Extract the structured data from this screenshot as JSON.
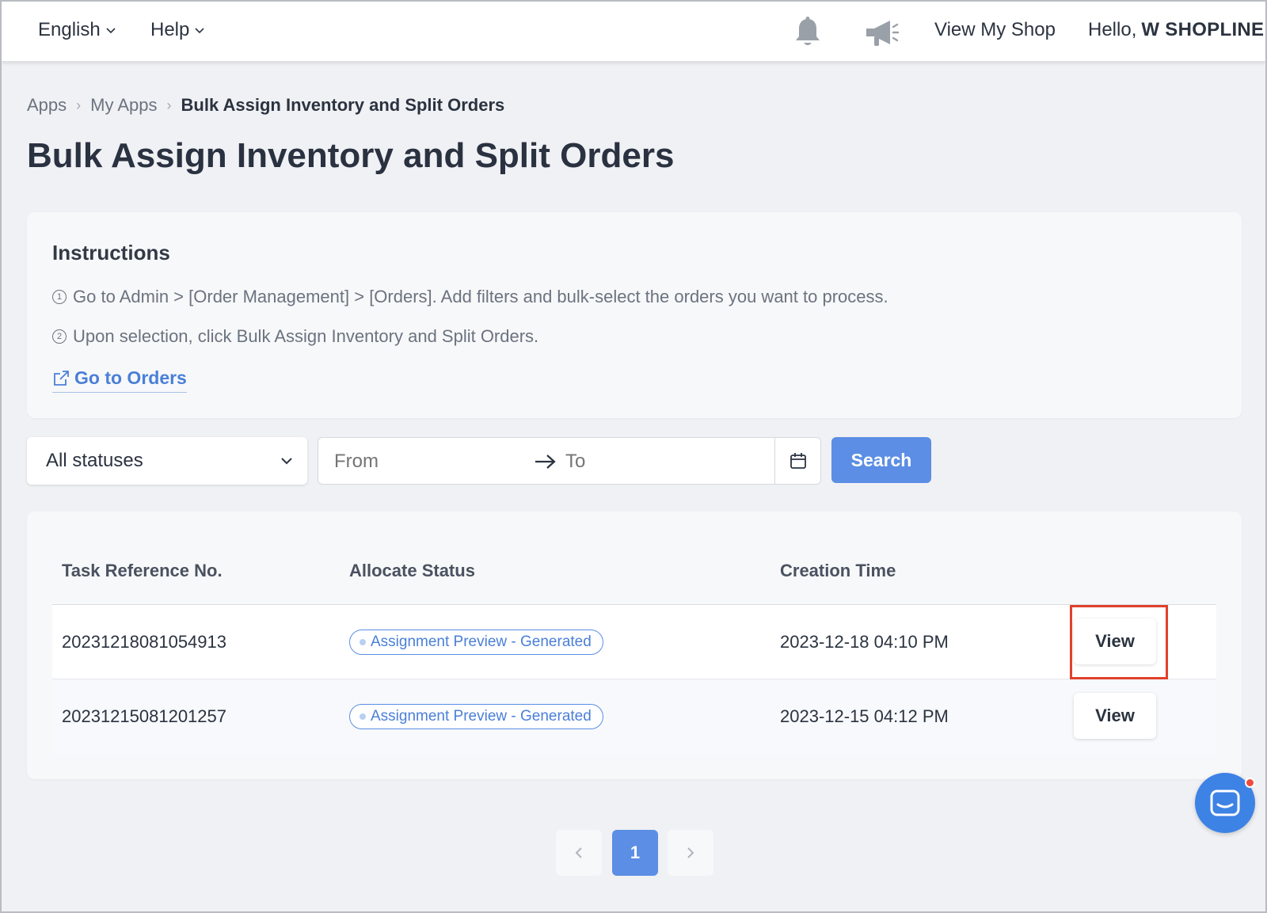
{
  "topbar": {
    "language": "English",
    "help": "Help",
    "notifications_icon": "bell-icon",
    "announcements_icon": "megaphone-icon",
    "view_shop": "View My Shop",
    "greeting": "Hello,",
    "user_name": "W SHOPLINE"
  },
  "breadcrumb": [
    "Apps",
    "My Apps",
    "Bulk Assign Inventory and Split Orders"
  ],
  "page_title": "Bulk Assign Inventory and Split Orders",
  "instructions": {
    "heading": "Instructions",
    "step1": "Go to Admin > [Order Management] > [Orders]. Add filters and bulk-select the orders you want to process.",
    "step2": "Upon selection, click Bulk Assign Inventory and Split Orders.",
    "step1_marker": "1",
    "step2_marker": "2",
    "link": "Go to Orders"
  },
  "filters": {
    "status_selected": "All statuses",
    "date_from_placeholder": "From",
    "date_to_placeholder": "To",
    "search_label": "Search"
  },
  "table": {
    "headers": [
      "Task Reference No.",
      "Allocate Status",
      "Creation Time"
    ],
    "rows": [
      {
        "ref": "20231218081054913",
        "status": "Assignment Preview - Generated",
        "time": "2023-12-18 04:10 PM",
        "action": "View"
      },
      {
        "ref": "20231215081201257",
        "status": "Assignment Preview - Generated",
        "time": "2023-12-15 04:12 PM",
        "action": "View"
      }
    ]
  },
  "pagination": {
    "current": "1"
  },
  "colors": {
    "primary": "#5b8ee4",
    "link": "#4a7fd8",
    "highlight": "#e0412c",
    "background": "#f0f1f4"
  }
}
